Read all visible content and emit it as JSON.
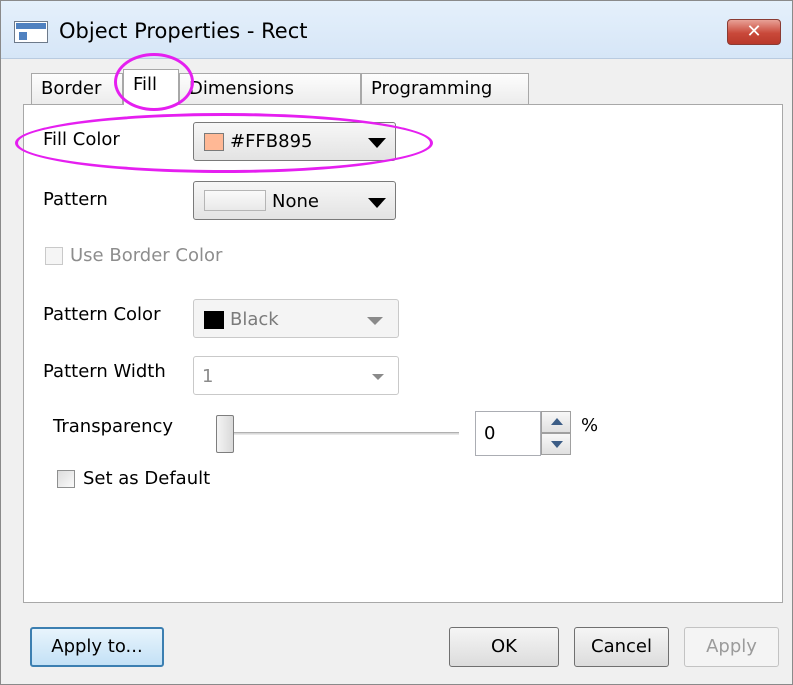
{
  "window": {
    "title": "Object Properties - Rect",
    "close_label": "✕"
  },
  "tabs": [
    {
      "label": "Border"
    },
    {
      "label": "Fill",
      "active": true
    },
    {
      "label": "Dimensions"
    },
    {
      "label": "Programming"
    }
  ],
  "fill": {
    "fill_color_label": "Fill Color",
    "fill_color_value": "#FFB895",
    "fill_color_swatch": "#FFB895",
    "pattern_label": "Pattern",
    "pattern_value": "None",
    "use_border_color_label": "Use Border Color",
    "pattern_color_label": "Pattern Color",
    "pattern_color_value": "Black",
    "pattern_color_swatch": "#000000",
    "pattern_width_label": "Pattern Width",
    "pattern_width_value": "1",
    "transparency_label": "Transparency",
    "transparency_value": "0",
    "transparency_unit": "%",
    "set_default_label": "Set as Default"
  },
  "buttons": {
    "apply_to": "Apply to...",
    "ok": "OK",
    "cancel": "Cancel",
    "apply": "Apply"
  },
  "annotation_color": "#E51FF0"
}
